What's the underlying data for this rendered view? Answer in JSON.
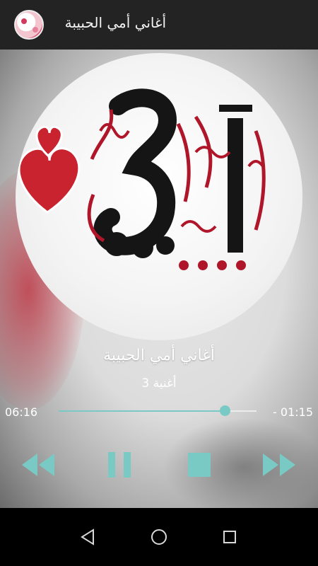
{
  "app": {
    "title": "أغاني أمي الحبيبة",
    "icon": "app-logo-icon"
  },
  "track": {
    "title": "أغاني أمي الحبيبة",
    "subtitle": "أغنية 3",
    "elapsed": "06:16",
    "remaining": "- 01:15",
    "progress": 0.84
  },
  "controls": {
    "rewind": "rewind-icon",
    "pause": "pause-icon",
    "stop": "stop-icon",
    "fast_forward": "fast-forward-icon"
  },
  "navbar": {
    "back": "back-icon",
    "home": "home-icon",
    "recents": "recents-icon"
  },
  "colors": {
    "accent": "#79c9c4",
    "heart": "#c8232f",
    "toolbar": "#232323"
  }
}
